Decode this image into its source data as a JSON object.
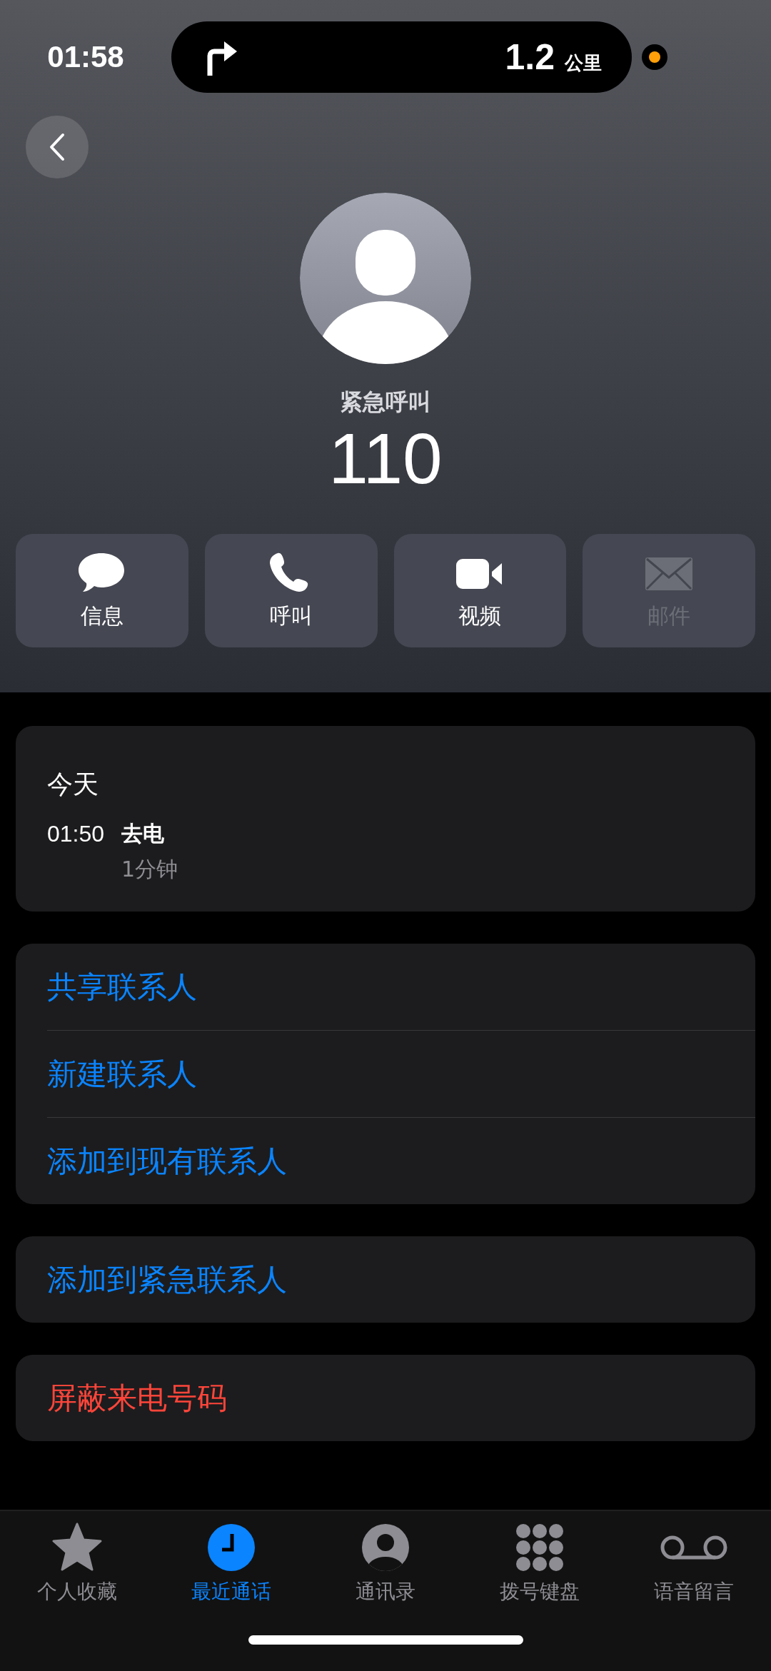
{
  "status_bar": {
    "time": "01:58",
    "island": {
      "distance": "1.2",
      "unit": "公里"
    }
  },
  "contact": {
    "name": "紧急呼叫",
    "number": "110"
  },
  "actions": [
    {
      "label": "信息",
      "kind": "message",
      "disabled": false
    },
    {
      "label": "呼叫",
      "kind": "phone",
      "disabled": false
    },
    {
      "label": "视频",
      "kind": "video",
      "disabled": false
    },
    {
      "label": "邮件",
      "kind": "mail",
      "disabled": true
    }
  ],
  "recents": {
    "day": "今天",
    "entries": [
      {
        "time": "01:50",
        "type": "去电",
        "duration": "1分钟"
      }
    ]
  },
  "option_groups": [
    [
      {
        "label": "共享联系人",
        "kind": "action"
      },
      {
        "label": "新建联系人",
        "kind": "action"
      },
      {
        "label": "添加到现有联系人",
        "kind": "action"
      }
    ],
    [
      {
        "label": "添加到紧急联系人",
        "kind": "action"
      }
    ],
    [
      {
        "label": "屏蔽来电号码",
        "kind": "destructive"
      }
    ]
  ],
  "tabs": [
    {
      "label": "个人收藏",
      "kind": "favorites",
      "selected": false
    },
    {
      "label": "最近通话",
      "kind": "recents",
      "selected": true
    },
    {
      "label": "通讯录",
      "kind": "contacts",
      "selected": false
    },
    {
      "label": "拨号键盘",
      "kind": "keypad",
      "selected": false
    },
    {
      "label": "语音留言",
      "kind": "voicemail",
      "selected": false
    }
  ]
}
